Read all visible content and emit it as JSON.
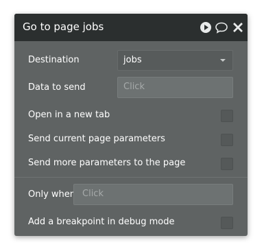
{
  "header": {
    "title": "Go to page jobs",
    "icons": [
      "play-icon",
      "comment-icon",
      "close-icon"
    ]
  },
  "destination": {
    "label": "Destination",
    "value": "jobs"
  },
  "data_to_send": {
    "label": "Data to send",
    "placeholder": "Click"
  },
  "open_new_tab": {
    "label": "Open in a new tab",
    "checked": false
  },
  "send_current_params": {
    "label": "Send current page parameters",
    "checked": false
  },
  "send_more_params": {
    "label": "Send more parameters to the page",
    "checked": false
  },
  "only_when": {
    "label": "Only when",
    "placeholder": "Click"
  },
  "breakpoint": {
    "label": "Add a breakpoint in debug mode",
    "checked": false
  },
  "colors": {
    "header_bg": "#2b2f2f",
    "panel_bg": "#5f6363",
    "text": "#ffffff"
  }
}
